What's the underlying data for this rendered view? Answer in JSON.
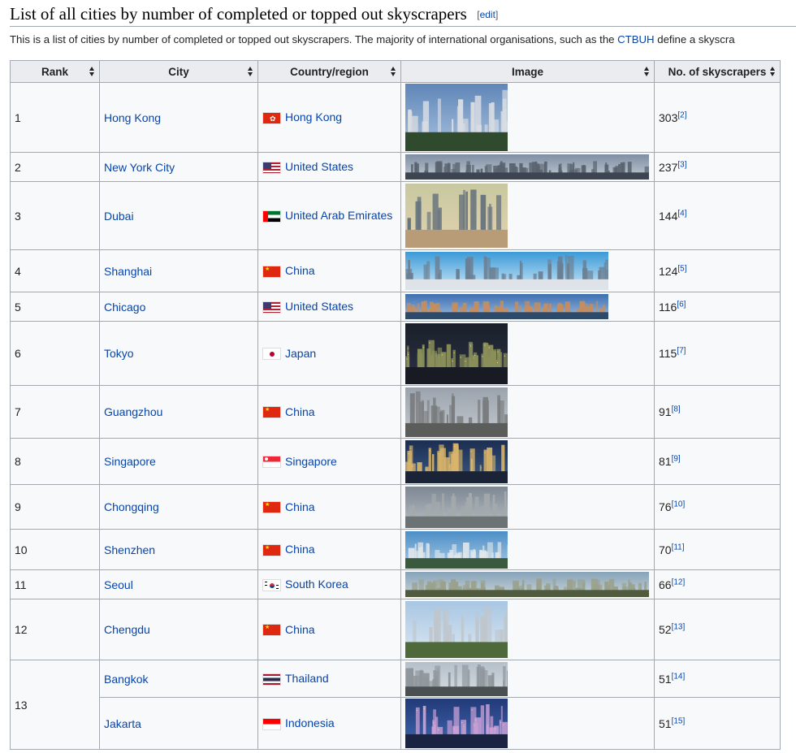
{
  "heading": {
    "title": "List of all cities by number of completed or topped out skyscrapers",
    "edit_label": "edit",
    "bracket_open": "[",
    "bracket_close": "]"
  },
  "intro": {
    "before": "This is a list of cities by number of completed or topped out skyscrapers. The majority of international organisations, such as the ",
    "link": "CTBUH",
    "after": " define a skyscra"
  },
  "columns": [
    "Rank",
    "City",
    "Country/region",
    "Image",
    "No. of skyscrapers"
  ],
  "rows": [
    {
      "rank": "1",
      "city": "Hong Kong",
      "country": "Hong Kong",
      "flag": "hk-flag",
      "count": "303",
      "ref": "[2]",
      "img": "hong-kong-skyline-image"
    },
    {
      "rank": "2",
      "city": "New York City",
      "country": "United States",
      "flag": "us-flag",
      "count": "237",
      "ref": "[3]",
      "img": "new-york-skyline-image"
    },
    {
      "rank": "3",
      "city": "Dubai",
      "country": "United Arab Emirates",
      "flag": "uae-flag",
      "count": "144",
      "ref": "[4]",
      "img": "dubai-skyline-image"
    },
    {
      "rank": "4",
      "city": "Shanghai",
      "country": "China",
      "flag": "cn-flag",
      "count": "124",
      "ref": "[5]",
      "img": "shanghai-skyline-image"
    },
    {
      "rank": "5",
      "city": "Chicago",
      "country": "United States",
      "flag": "us-flag",
      "count": "116",
      "ref": "[6]",
      "img": "chicago-skyline-image"
    },
    {
      "rank": "6",
      "city": "Tokyo",
      "country": "Japan",
      "flag": "jp-flag",
      "count": "115",
      "ref": "[7]",
      "img": "tokyo-skyline-image"
    },
    {
      "rank": "7",
      "city": "Guangzhou",
      "country": "China",
      "flag": "cn-flag",
      "count": "91",
      "ref": "[8]",
      "img": "guangzhou-skyline-image"
    },
    {
      "rank": "8",
      "city": "Singapore",
      "country": "Singapore",
      "flag": "sg-flag",
      "count": "81",
      "ref": "[9]",
      "img": "singapore-skyline-image"
    },
    {
      "rank": "9",
      "city": "Chongqing",
      "country": "China",
      "flag": "cn-flag",
      "count": "76",
      "ref": "[10]",
      "img": "chongqing-skyline-image"
    },
    {
      "rank": "10",
      "city": "Shenzhen",
      "country": "China",
      "flag": "cn-flag",
      "count": "70",
      "ref": "[11]",
      "img": "shenzhen-skyline-image"
    },
    {
      "rank": "11",
      "city": "Seoul",
      "country": "South Korea",
      "flag": "kr-flag",
      "count": "66",
      "ref": "[12]",
      "img": "seoul-skyline-image"
    },
    {
      "rank": "12",
      "city": "Chengdu",
      "country": "China",
      "flag": "cn-flag",
      "count": "52",
      "ref": "[13]",
      "img": "chengdu-skyline-image"
    },
    {
      "rank": "13",
      "city": "Bangkok",
      "country": "Thailand",
      "flag": "th-flag",
      "count": "51",
      "ref": "[14]",
      "img": "bangkok-skyline-image"
    },
    {
      "rank": "",
      "city": "Jakarta",
      "country": "Indonesia",
      "flag": "id-flag",
      "count": "51",
      "ref": "[15]",
      "img": "jakarta-skyline-image"
    }
  ],
  "colors": {
    "link": "#0645ad",
    "header_bg": "#eaecf0",
    "cell_bg": "#f8f9fa",
    "border": "#a2a9b1"
  }
}
